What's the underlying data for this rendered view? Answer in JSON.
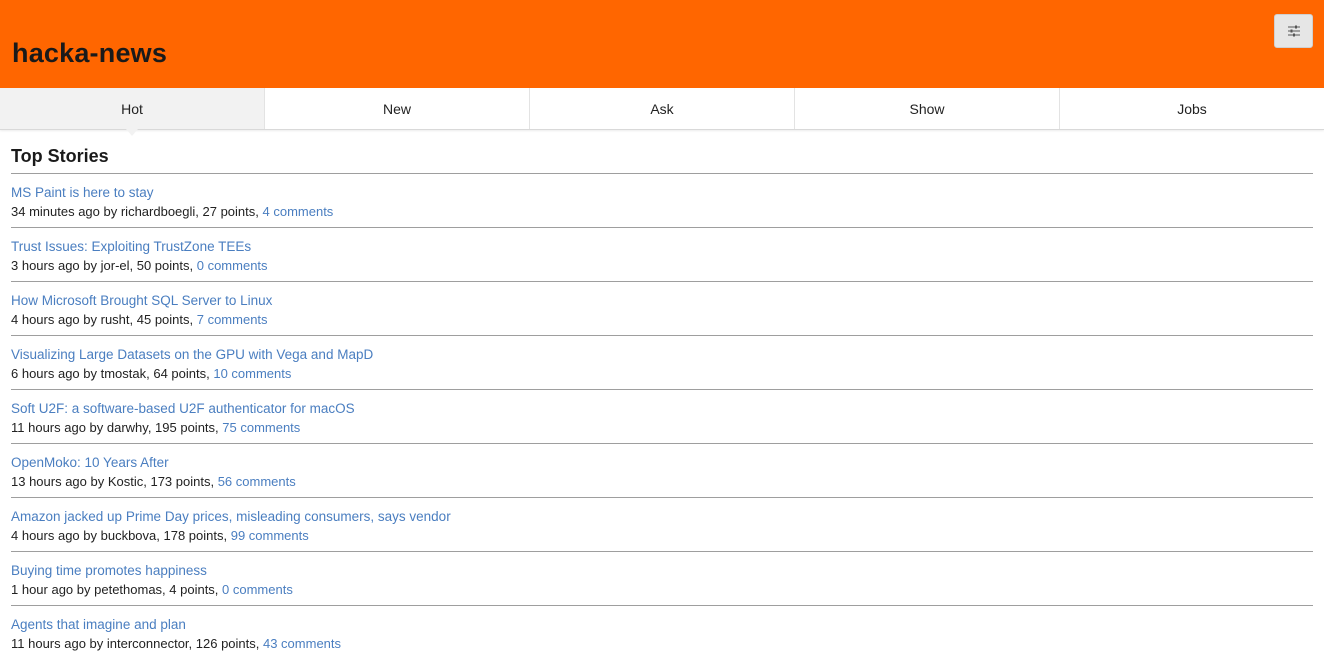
{
  "app": {
    "title": "hacka-news",
    "settings_icon": "sliders-icon"
  },
  "tabs": [
    {
      "label": "Hot",
      "active": true
    },
    {
      "label": "New",
      "active": false
    },
    {
      "label": "Ask",
      "active": false
    },
    {
      "label": "Show",
      "active": false
    },
    {
      "label": "Jobs",
      "active": false
    }
  ],
  "main": {
    "section_title": "Top Stories"
  },
  "stories": [
    {
      "title": "MS Paint is here to stay",
      "meta": "34 minutes ago by richardboegli, 27 points, ",
      "comments": "4 comments"
    },
    {
      "title": "Trust Issues: Exploiting TrustZone TEEs",
      "meta": "3 hours ago by jor-el, 50 points, ",
      "comments": "0 comments"
    },
    {
      "title": "How Microsoft Brought SQL Server to Linux",
      "meta": "4 hours ago by rusht, 45 points, ",
      "comments": "7 comments"
    },
    {
      "title": "Visualizing Large Datasets on the GPU with Vega and MapD",
      "meta": "6 hours ago by tmostak, 64 points, ",
      "comments": "10 comments"
    },
    {
      "title": "Soft U2F: a software-based U2F authenticator for macOS",
      "meta": "11 hours ago by darwhy, 195 points, ",
      "comments": "75 comments"
    },
    {
      "title": "OpenMoko: 10 Years After",
      "meta": "13 hours ago by Kostic, 173 points, ",
      "comments": "56 comments"
    },
    {
      "title": "Amazon jacked up Prime Day prices, misleading consumers, says vendor",
      "meta": "4 hours ago by buckbova, 178 points, ",
      "comments": "99 comments"
    },
    {
      "title": "Buying time promotes happiness",
      "meta": "1 hour ago by petethomas, 4 points, ",
      "comments": "0 comments"
    },
    {
      "title": "Agents that imagine and plan",
      "meta": "11 hours ago by interconnector, 126 points, ",
      "comments": "43 comments"
    }
  ],
  "colors": {
    "header_bg": "#ff6600",
    "link": "#4a7ec0",
    "active_tab_bg": "#f2f2f2"
  }
}
